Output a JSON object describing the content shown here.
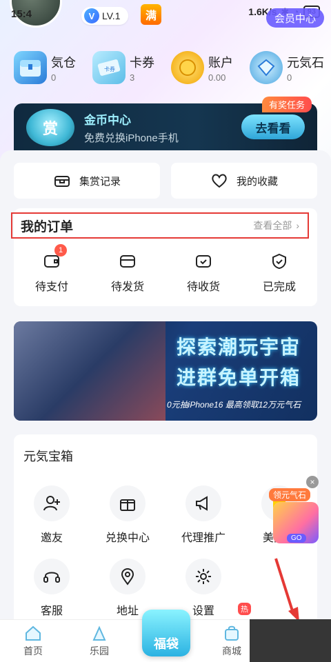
{
  "status": {
    "time": "15:4",
    "net_speed": "1.6K/s",
    "battery": "93"
  },
  "header": {
    "level": "LV.1",
    "level_icon": "V",
    "man_badge": "满",
    "member_center": "会员中心"
  },
  "assets": [
    {
      "name": "気仓",
      "value": "0",
      "icon": "chest-icon"
    },
    {
      "name": "卡券",
      "value": "3",
      "icon": "ticket-icon"
    },
    {
      "name": "账户",
      "value": "0.00",
      "icon": "coin-icon"
    },
    {
      "name": "元気石",
      "value": "0",
      "icon": "gem-icon"
    }
  ],
  "coin_banner": {
    "title": "金币中心",
    "subtitle": "免费兑换iPhone手机",
    "button": "去看看",
    "tag": "有奖任务",
    "coin_char": "赏"
  },
  "quick": {
    "collect": "集赏记录",
    "favorites": "我的收藏"
  },
  "orders": {
    "title": "我的订单",
    "view_all": "查看全部",
    "items": [
      {
        "label": "待支付",
        "badge": "1"
      },
      {
        "label": "待发货"
      },
      {
        "label": "待收货"
      },
      {
        "label": "已完成"
      }
    ]
  },
  "promo": {
    "line1": "探索潮玩宇宙",
    "line2": "进群免单开箱",
    "sub": "0元抽iPhone16  最高领取12万元气石"
  },
  "box": {
    "title": "元気宝箱",
    "items": [
      {
        "label": "邀友"
      },
      {
        "label": "兑换中心"
      },
      {
        "label": "代理推广"
      },
      {
        "label": "美团返"
      },
      {
        "label": "客服"
      },
      {
        "label": "地址"
      },
      {
        "label": "设置"
      }
    ]
  },
  "float_ad": {
    "label": "领元气石",
    "go": "GO"
  },
  "tabs": [
    {
      "label": "首页"
    },
    {
      "label": "乐园"
    },
    {
      "label": "福袋"
    },
    {
      "label": "商城",
      "hot": "热"
    }
  ],
  "colors": {
    "accent": "#6a5cff",
    "highlight_border": "#e53935",
    "banner_bg": "#102a3f"
  }
}
